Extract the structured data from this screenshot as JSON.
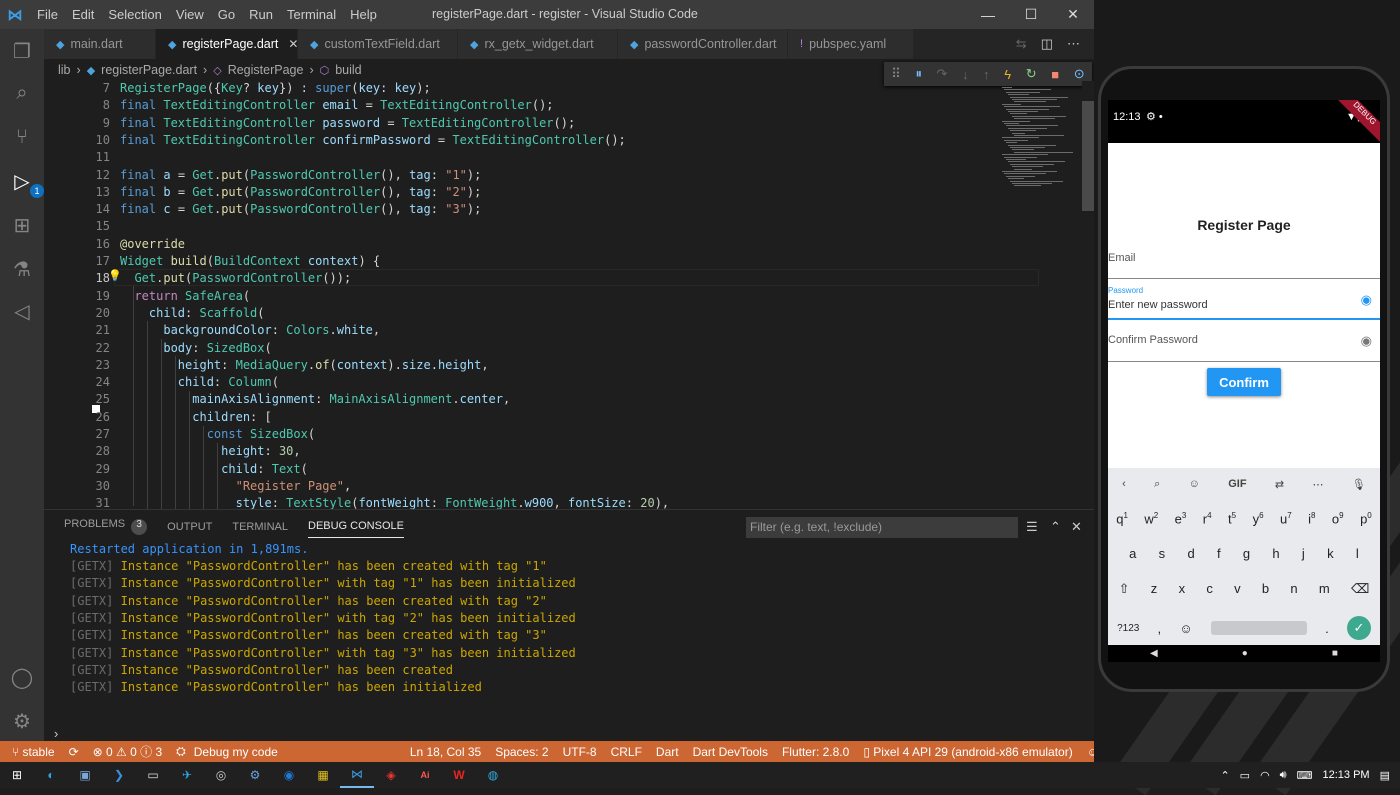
{
  "window": {
    "title": "registerPage.dart - register - Visual Studio Code"
  },
  "menu": [
    "File",
    "Edit",
    "Selection",
    "View",
    "Go",
    "Run",
    "Terminal",
    "Help"
  ],
  "tabs": [
    {
      "label": "main.dart",
      "active": false
    },
    {
      "label": "registerPage.dart",
      "active": true
    },
    {
      "label": "customTextField.dart",
      "active": false
    },
    {
      "label": "rx_getx_widget.dart",
      "active": false
    },
    {
      "label": "passwordController.dart",
      "active": false
    },
    {
      "label": "pubspec.yaml",
      "active": false
    }
  ],
  "breadcrumb": [
    "lib",
    "registerPage.dart",
    "RegisterPage",
    "build"
  ],
  "activity": {
    "debug_badge": "1"
  },
  "editor": {
    "line_numbers": [
      "7",
      "8",
      "9",
      "10",
      "11",
      "12",
      "13",
      "14",
      "15",
      "16",
      "17",
      "18",
      "19",
      "20",
      "21",
      "22",
      "23",
      "24",
      "25",
      "26",
      "27",
      "28",
      "29",
      "30",
      "31"
    ],
    "current_line": "18"
  },
  "panel": {
    "tabs": [
      "PROBLEMS",
      "OUTPUT",
      "TERMINAL",
      "DEBUG CONSOLE"
    ],
    "problems_count": "3",
    "filter_placeholder": "Filter (e.g. text, !exclude)",
    "restart": "Restarted application in 1,891ms.",
    "log_tag": "[GETX]",
    "logs": [
      "Instance \"PasswordController\" has been created with tag \"1\"",
      "Instance \"PasswordController\" with tag \"1\" has been initialized",
      "Instance \"PasswordController\" has been created with tag \"2\"",
      "Instance \"PasswordController\" with tag \"2\" has been initialized",
      "Instance \"PasswordController\" has been created with tag \"3\"",
      "Instance \"PasswordController\" with tag \"3\" has been initialized",
      "Instance \"PasswordController\" has been created",
      "Instance \"PasswordController\" has been initialized"
    ]
  },
  "status": {
    "branch": "stable",
    "problems": "⊗ 0 ⚠ 0 ⓘ 3",
    "launch": "Debug my code",
    "position": "Ln 18, Col 35",
    "spaces": "Spaces: 2",
    "encoding": "UTF-8",
    "eol": "CRLF",
    "language": "Dart",
    "devtools": "Dart DevTools",
    "flutter": "Flutter: 2.8.0",
    "device": "Pixel 4 API 29 (android-x86 emulator)"
  },
  "phone": {
    "time": "12:13",
    "page_title": "Register Page",
    "email_label": "Email",
    "password_label": "Password",
    "password_hint": "Enter new password",
    "confirm_label": "Confirm Password",
    "button": "Confirm",
    "kb_row1": [
      "q",
      "w",
      "e",
      "r",
      "t",
      "y",
      "u",
      "i",
      "o",
      "p"
    ],
    "kb_row1_num": [
      "1",
      "2",
      "3",
      "4",
      "5",
      "6",
      "7",
      "8",
      "9",
      "0"
    ],
    "kb_row2": [
      "a",
      "s",
      "d",
      "f",
      "g",
      "h",
      "j",
      "k",
      "l"
    ],
    "kb_row3": [
      "z",
      "x",
      "c",
      "v",
      "b",
      "n",
      "m"
    ],
    "kb_symbols": "?123",
    "kb_gif": "GIF"
  },
  "taskbar": {
    "time": "12:13 PM"
  },
  "colors": {
    "statusbar": "#cc6633",
    "accent": "#2196f3"
  }
}
